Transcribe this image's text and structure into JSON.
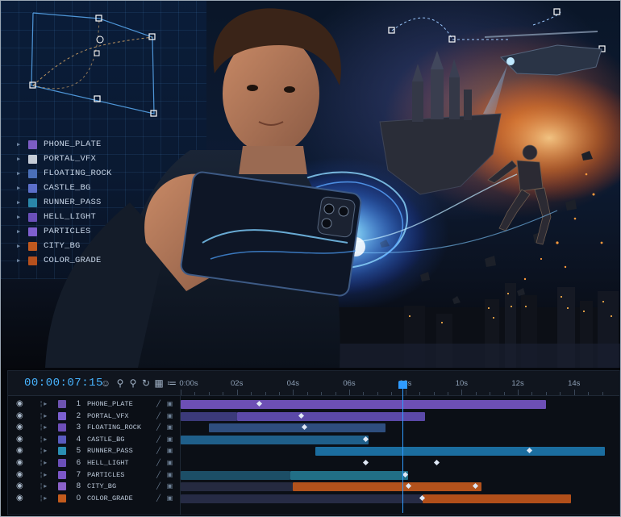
{
  "layer_panel": {
    "items": [
      {
        "label": "PHONE_PLATE",
        "color": "#7b5cc4"
      },
      {
        "label": "PORTAL_VFX",
        "color": "#c5ccd6"
      },
      {
        "label": "FLOATING_ROCK",
        "color": "#4a6fb8"
      },
      {
        "label": "CASTLE_BG",
        "color": "#5c6fc9"
      },
      {
        "label": "RUNNER_PASS",
        "color": "#2a86a8"
      },
      {
        "label": "HELL_LIGHT",
        "color": "#6a4fb8"
      },
      {
        "label": "PARTICLES",
        "color": "#7f5fcf"
      },
      {
        "label": "CITY_BG",
        "color": "#c0591f"
      },
      {
        "label": "COLOR_GRADE",
        "color": "#b5501d"
      }
    ]
  },
  "timeline": {
    "timecode": "00:00:07:15",
    "tools": [
      "person-icon",
      "search-icon",
      "search-icon",
      "refresh-icon",
      "grid-icon",
      "graph-icon"
    ],
    "ruler_labels": [
      "0:00s",
      "02s",
      "04s",
      "06s",
      "08s",
      "10s",
      "12s",
      "14s"
    ],
    "playhead_seconds": 7.9,
    "layers": [
      {
        "num": "1",
        "name": "PHONE_PLATE",
        "color": "#6d53b0",
        "bars": [
          {
            "start": 0.0,
            "end": 13.0,
            "color": "#6d4fb5"
          }
        ],
        "keys": [
          2.8
        ]
      },
      {
        "num": "2",
        "name": "PORTAL_VFX",
        "color": "#7b5fcf",
        "bars": [
          {
            "start": 0.0,
            "end": 2.0,
            "color": "#3b3a7a"
          },
          {
            "start": 2.0,
            "end": 8.7,
            "color": "#5b49a8"
          }
        ],
        "keys": [
          4.3
        ]
      },
      {
        "num": "3",
        "name": "FLOATING_ROCK",
        "color": "#6e4fb8",
        "bars": [
          {
            "start": 1.0,
            "end": 7.3,
            "color": "#2e4e7e"
          }
        ],
        "keys": [
          4.4
        ]
      },
      {
        "num": "4",
        "name": "CASTLE_BG",
        "color": "#5a5bbf",
        "bars": [
          {
            "start": 0.0,
            "end": 6.7,
            "color": "#1f5f8a"
          }
        ],
        "keys": [
          6.6
        ]
      },
      {
        "num": "5",
        "name": "RUNNER_PASS",
        "color": "#2a8fb3",
        "bars": [
          {
            "start": 4.8,
            "end": 15.1,
            "color": "#1b6d9f"
          }
        ],
        "keys": [
          12.4
        ]
      },
      {
        "num": "6",
        "name": "HELL_LIGHT",
        "color": "#6a4fb8",
        "bars": [],
        "keys": [
          6.6,
          9.1
        ]
      },
      {
        "num": "7",
        "name": "PARTICLES",
        "color": "#7b56c7",
        "bars": [
          {
            "start": 0.0,
            "end": 3.9,
            "color": "#1c4e66"
          },
          {
            "start": 3.9,
            "end": 8.1,
            "color": "#216f86"
          }
        ],
        "keys": [
          8.0
        ]
      },
      {
        "num": "8",
        "name": "CITY_BG",
        "color": "#8b62c9",
        "bars": [
          {
            "start": 0.0,
            "end": 4.0,
            "color": "#252a40"
          },
          {
            "start": 4.0,
            "end": 10.7,
            "color": "#b3521c"
          }
        ],
        "keys": [
          8.1,
          10.5
        ]
      },
      {
        "num": "0",
        "name": "COLOR_GRADE",
        "color": "#c35b1d",
        "bars": [
          {
            "start": 0.0,
            "end": 8.6,
            "color": "#262b45"
          },
          {
            "start": 8.6,
            "end": 13.9,
            "color": "#b14f1a"
          }
        ],
        "keys": [
          8.6
        ]
      }
    ]
  }
}
